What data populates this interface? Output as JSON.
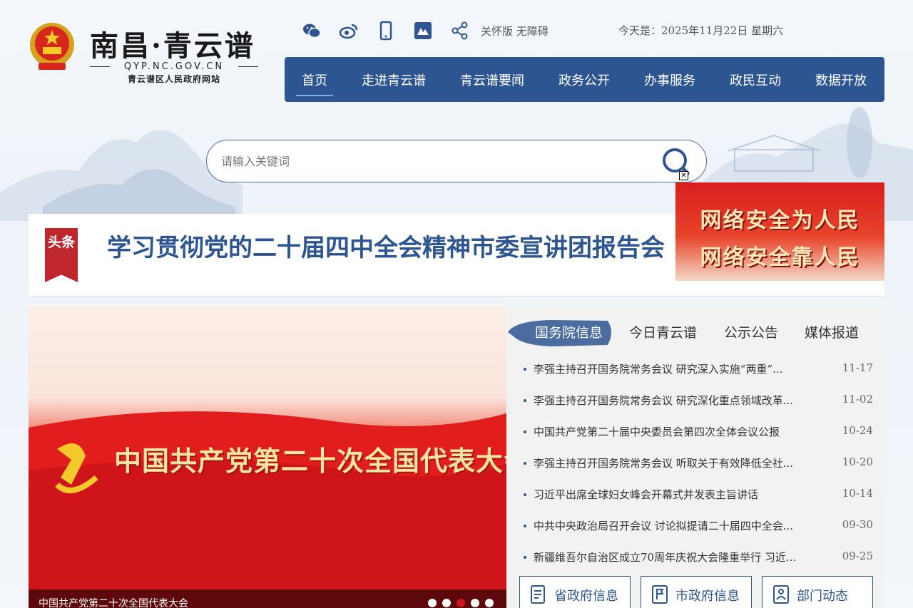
{
  "site": {
    "title": "南昌·青云谱",
    "domain": "QYP.NC.GOV.CN",
    "subtitle": "青云谱区人民政府网站"
  },
  "toolbar": {
    "icons": [
      "wechat-icon",
      "weibo-icon",
      "mobile-icon",
      "app-icon",
      "share-icon"
    ],
    "care_link": "关怀版 无障碍",
    "date": "今天是：2025年11月22日 星期六"
  },
  "nav": {
    "items": [
      "首页",
      "走进青云谱",
      "青云谱要闻",
      "政务公开",
      "办事服务",
      "政民互动",
      "数据开放"
    ],
    "active_index": 0
  },
  "search": {
    "placeholder": "请输入关键词"
  },
  "ad": {
    "line1": "网络安全为人民",
    "line2": "网络安全靠人民",
    "close_label": "✕"
  },
  "headline": {
    "tag": "头条",
    "text": "学习贯彻党的二十届四中全会精神市委宣讲团报告会"
  },
  "slider": {
    "slide_title": "中国共产党第二十次全国代表大会",
    "caption": "中国共产党第二十次全国代表大会",
    "dot_count": 5,
    "active_dot": 2
  },
  "news": {
    "tabs": [
      "国务院信息",
      "今日青云谱",
      "公示公告",
      "媒体报道"
    ],
    "active_tab": 0,
    "items": [
      {
        "title": "李强主持召开国务院常务会议 研究深入实施“两重”...",
        "date": "11-17"
      },
      {
        "title": "李强主持召开国务院常务会议 研究深化重点领域改革...",
        "date": "11-02"
      },
      {
        "title": "中国共产党第二十届中央委员会第四次全体会议公报",
        "date": "10-24"
      },
      {
        "title": "李强主持召开国务院常务会议 听取关于有效降低全社...",
        "date": "10-20"
      },
      {
        "title": "习近平出席全球妇女峰会开幕式并发表主旨讲话",
        "date": "10-14"
      },
      {
        "title": "中共中央政治局召开会议 讨论拟提请二十届四中全会...",
        "date": "09-30"
      },
      {
        "title": "新疆维吾尔自治区成立70周年庆祝大会隆重举行 习近...",
        "date": "09-25"
      }
    ],
    "quick_links": [
      "省政府信息",
      "市政府信息",
      "部门动态"
    ]
  },
  "colors": {
    "brand": "#2d5591",
    "accent_red": "#c0272d"
  }
}
